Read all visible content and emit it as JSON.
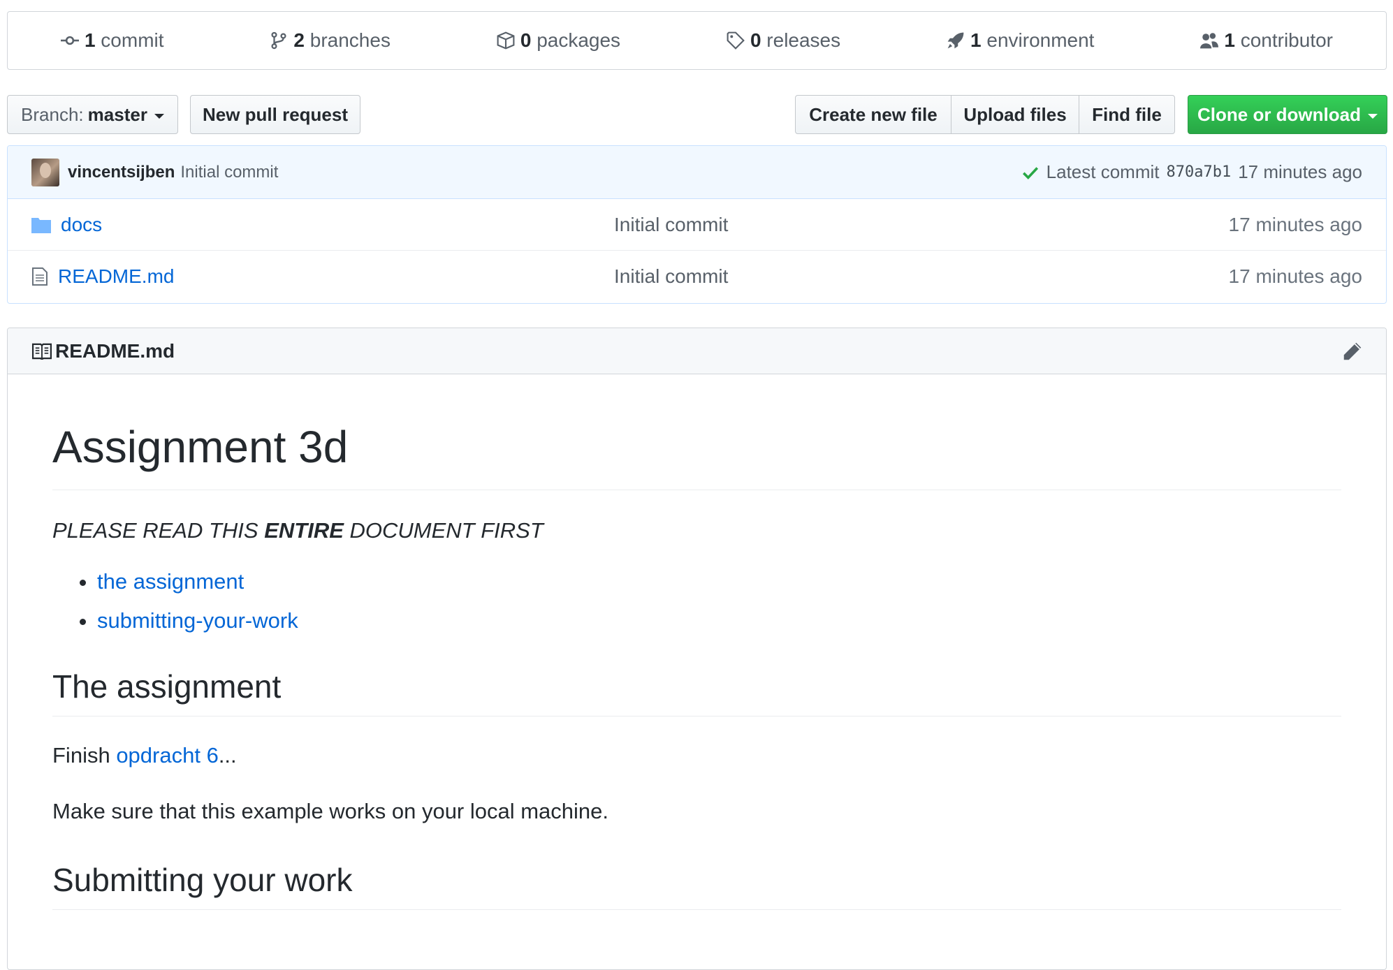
{
  "summary": {
    "commits": {
      "count": "1",
      "label": "commit"
    },
    "branches": {
      "count": "2",
      "label": "branches"
    },
    "packages": {
      "count": "0",
      "label": "packages"
    },
    "releases": {
      "count": "0",
      "label": "releases"
    },
    "environments": {
      "count": "1",
      "label": "environment"
    },
    "contributors": {
      "count": "1",
      "label": "contributor"
    }
  },
  "toolbar": {
    "branch_prefix": "Branch:",
    "branch_name": "master",
    "new_pr": "New pull request",
    "create_file": "Create new file",
    "upload_files": "Upload files",
    "find_file": "Find file",
    "clone": "Clone or download"
  },
  "commit": {
    "author": "vincentsijben",
    "message": "Initial commit",
    "latest_label": "Latest commit",
    "sha": "870a7b1",
    "age": "17 minutes ago"
  },
  "files": [
    {
      "name": "docs",
      "type": "folder",
      "commit": "Initial commit",
      "age": "17 minutes ago"
    },
    {
      "name": "README.md",
      "type": "file",
      "commit": "Initial commit",
      "age": "17 minutes ago"
    }
  ],
  "readme": {
    "filename": "README.md",
    "title": "Assignment 3d",
    "notice_before": "PLEASE READ THIS ",
    "notice_bold": "ENTIRE",
    "notice_after": " DOCUMENT FIRST",
    "toc": [
      "the assignment",
      "submitting-your-work"
    ],
    "h2_assignment": "The assignment",
    "finish_prefix": "Finish ",
    "finish_link": "opdracht 6",
    "finish_suffix": "...",
    "make_sure": "Make sure that this example works on your local machine.",
    "h2_submit": "Submitting your work"
  },
  "colors": {
    "link": "#0366d6",
    "clone": "#28a745",
    "check": "#28a745"
  }
}
